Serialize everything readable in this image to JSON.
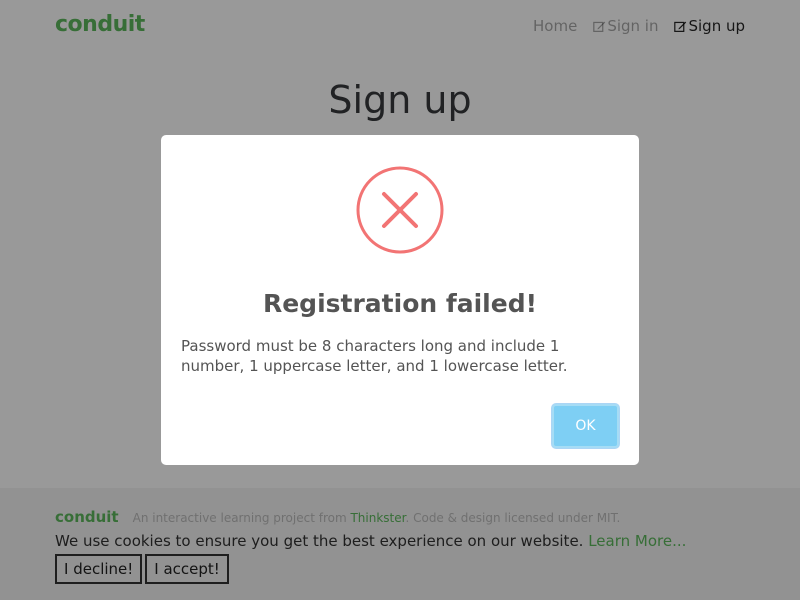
{
  "header": {
    "brand": "conduit",
    "nav": {
      "home": "Home",
      "sign_in": "Sign in",
      "sign_up": "Sign up"
    }
  },
  "main": {
    "title": "Sign up"
  },
  "footer": {
    "logo": "conduit",
    "attribution_prefix": "An interactive learning project from ",
    "attribution_link": "Thinkster",
    "attribution_suffix": ". Code & design licensed under MIT."
  },
  "cookie_banner": {
    "text": "We use cookies to ensure you get the best experience on our website. ",
    "learn_more": "Learn More...",
    "decline": "I decline!",
    "accept": "I accept!"
  },
  "modal": {
    "icon": "error-x-icon",
    "title": "Registration failed!",
    "message": "Password must be 8 characters long and include 1 number, 1 uppercase letter, and 1 lowercase letter.",
    "ok": "OK"
  },
  "colors": {
    "brand": "#5cb85c",
    "error": "#f27474",
    "ok_button": "#7ecff4"
  }
}
